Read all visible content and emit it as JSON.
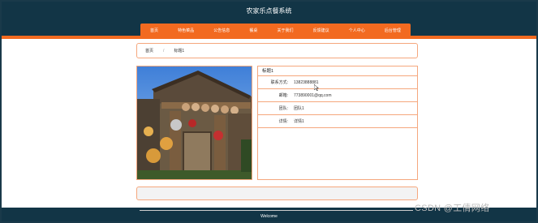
{
  "site_title": "农家乐点餐系统",
  "nav": [
    "首页",
    "特色菜品",
    "公告信息",
    "餐桌",
    "关于我们",
    "反馈建议",
    "个人中心",
    "后台管理"
  ],
  "breadcrumb": {
    "home": "首页",
    "separator": "/",
    "current": "标题1"
  },
  "detail": {
    "title": "标题1",
    "rows": [
      {
        "label": "联系方式:",
        "value": "13823888881"
      },
      {
        "label": "邮箱:",
        "value": "773890001@qq.com"
      },
      {
        "label": "团队:",
        "value": "团队1"
      },
      {
        "label": "详情:",
        "value": "详情1"
      }
    ]
  },
  "footer": {
    "text": "Welcome"
  },
  "watermark": "CSDN @工倩网络",
  "colors": {
    "header": "#123546",
    "accent": "#f26a20",
    "border": "#f5a77d"
  },
  "icons": {
    "cursor": "mouse-pointer-icon"
  }
}
